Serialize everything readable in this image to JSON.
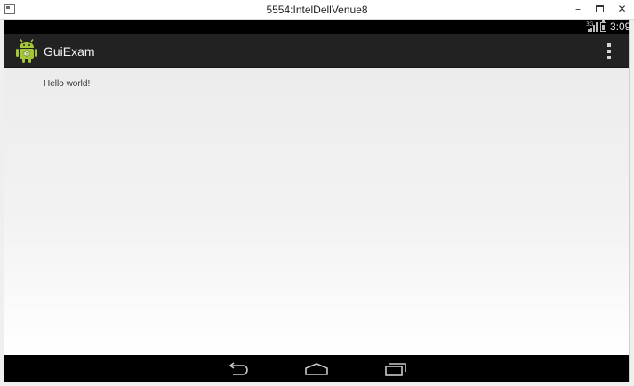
{
  "window": {
    "title": "5554:IntelDellVenue8",
    "minimize_glyph": "–",
    "close_glyph": "✕"
  },
  "status_bar": {
    "network_label": "3G",
    "time": "3:09",
    "icons": [
      "signal-icon",
      "battery-icon"
    ]
  },
  "action_bar": {
    "app_title": "GuiExam",
    "icons": [
      "android-app-icon",
      "overflow-menu-icon"
    ]
  },
  "content": {
    "text": "Hello world!"
  },
  "nav_bar": {
    "icons": [
      "back-icon",
      "home-icon",
      "recent-apps-icon"
    ]
  },
  "colors": {
    "action_bar": "#222222",
    "status_bar": "#000000",
    "android_green": "#a4c639"
  }
}
